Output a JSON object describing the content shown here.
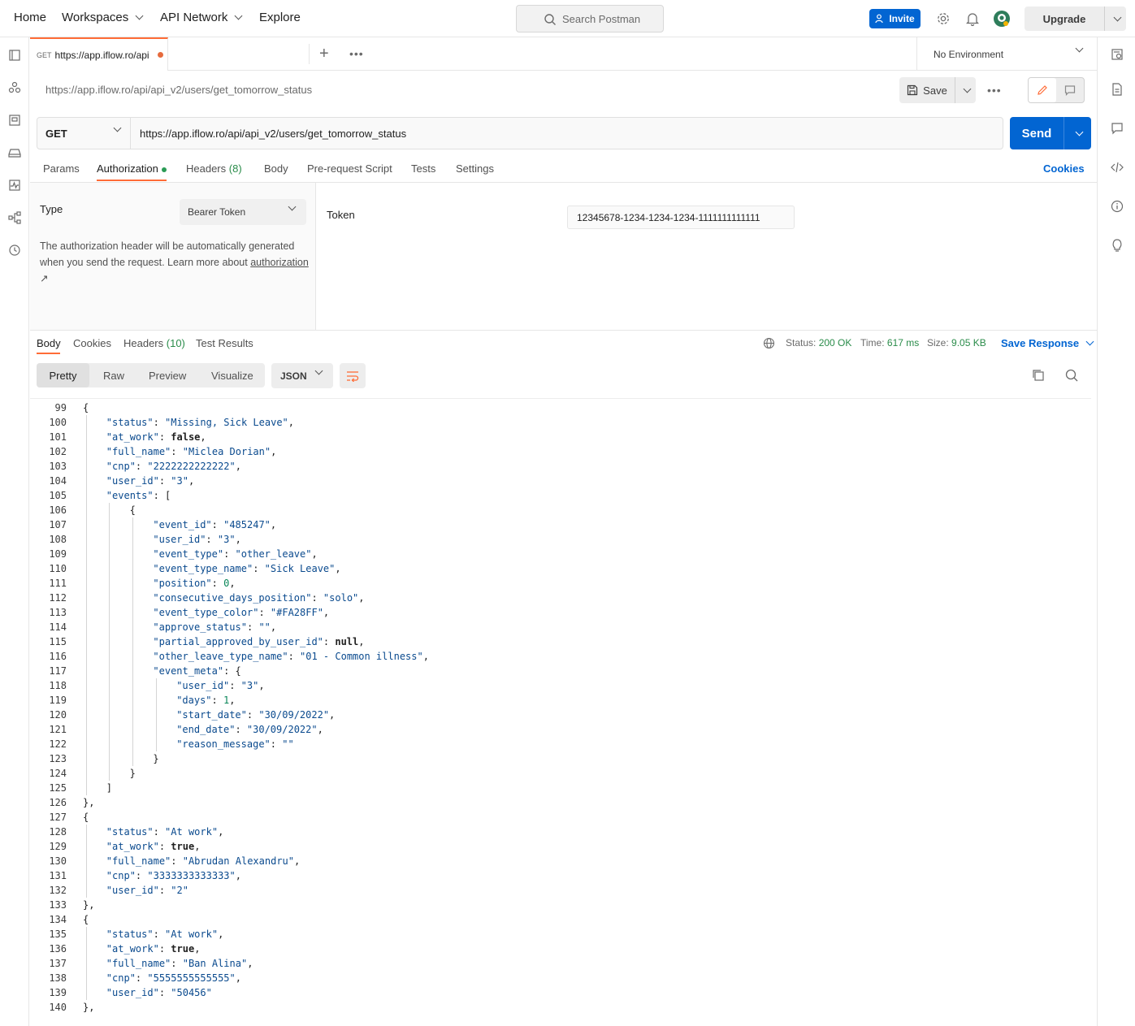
{
  "topbar": {
    "nav": [
      "Home",
      "Workspaces",
      "API Network",
      "Explore"
    ],
    "search_placeholder": "Search Postman",
    "invite_label": "Invite",
    "upgrade_label": "Upgrade"
  },
  "tabs": {
    "active_tab": {
      "method": "GET",
      "title": "https://app.iflow.ro/api"
    },
    "environment": "No Environment"
  },
  "request": {
    "name": "https://app.iflow.ro/api/api_v2/users/get_tomorrow_status",
    "save_label": "Save",
    "method": "GET",
    "url": "https://app.iflow.ro/api/api_v2/users/get_tomorrow_status",
    "send_label": "Send",
    "tabs": [
      {
        "label": "Params"
      },
      {
        "label": "Authorization"
      },
      {
        "label": "Headers",
        "count": "(8)"
      },
      {
        "label": "Body"
      },
      {
        "label": "Pre-request Script"
      },
      {
        "label": "Tests"
      },
      {
        "label": "Settings"
      }
    ],
    "cookies_label": "Cookies"
  },
  "auth": {
    "type_label": "Type",
    "type_value": "Bearer Token",
    "description": "The authorization header will be automatically generated when you send the request. Learn more about",
    "link_text": "authorization",
    "link_arrow": "↗",
    "token_label": "Token",
    "token_value": "12345678-1234-1234-1234-1111111111111"
  },
  "response": {
    "tabs": [
      {
        "label": "Body"
      },
      {
        "label": "Cookies"
      },
      {
        "label": "Headers",
        "count": "(10)"
      },
      {
        "label": "Test Results"
      }
    ],
    "status_label": "Status:",
    "status_value": "200 OK",
    "time_label": "Time:",
    "time_value": "617 ms",
    "size_label": "Size:",
    "size_value": "9.05 KB",
    "save_response_label": "Save Response",
    "view_modes": [
      "Pretty",
      "Raw",
      "Preview",
      "Visualize"
    ],
    "format": "JSON"
  },
  "code": {
    "lines": [
      {
        "n": "99",
        "indent": 1,
        "t": "{"
      },
      {
        "n": "100",
        "indent": 2,
        "key": "status",
        "val": "\"Missing, Sick Leave\"",
        "vt": "s",
        "tail": ","
      },
      {
        "n": "101",
        "indent": 2,
        "key": "at_work",
        "val": "false",
        "vt": "b",
        "tail": ","
      },
      {
        "n": "102",
        "indent": 2,
        "key": "full_name",
        "val": "\"Miclea Dorian\"",
        "vt": "s",
        "tail": ","
      },
      {
        "n": "103",
        "indent": 2,
        "key": "cnp",
        "val": "\"2222222222222\"",
        "vt": "s",
        "tail": ","
      },
      {
        "n": "104",
        "indent": 2,
        "key": "user_id",
        "val": "\"3\"",
        "vt": "s",
        "tail": ","
      },
      {
        "n": "105",
        "indent": 2,
        "key": "events",
        "val": "[",
        "vt": "p",
        "tail": ""
      },
      {
        "n": "106",
        "indent": 3,
        "t": "{"
      },
      {
        "n": "107",
        "indent": 4,
        "key": "event_id",
        "val": "\"485247\"",
        "vt": "s",
        "tail": ","
      },
      {
        "n": "108",
        "indent": 4,
        "key": "user_id",
        "val": "\"3\"",
        "vt": "s",
        "tail": ","
      },
      {
        "n": "109",
        "indent": 4,
        "key": "event_type",
        "val": "\"other_leave\"",
        "vt": "s",
        "tail": ","
      },
      {
        "n": "110",
        "indent": 4,
        "key": "event_type_name",
        "val": "\"Sick Leave\"",
        "vt": "s",
        "tail": ","
      },
      {
        "n": "111",
        "indent": 4,
        "key": "position",
        "val": "0",
        "vt": "n",
        "tail": ","
      },
      {
        "n": "112",
        "indent": 4,
        "key": "consecutive_days_position",
        "val": "\"solo\"",
        "vt": "s",
        "tail": ","
      },
      {
        "n": "113",
        "indent": 4,
        "key": "event_type_color",
        "val": "\"#FA28FF\"",
        "vt": "s",
        "tail": ","
      },
      {
        "n": "114",
        "indent": 4,
        "key": "approve_status",
        "val": "\"\"",
        "vt": "s",
        "tail": ","
      },
      {
        "n": "115",
        "indent": 4,
        "key": "partial_approved_by_user_id",
        "val": "null",
        "vt": "b",
        "tail": ","
      },
      {
        "n": "116",
        "indent": 4,
        "key": "other_leave_type_name",
        "val": "\"01 - Common illness\"",
        "vt": "s",
        "tail": ","
      },
      {
        "n": "117",
        "indent": 4,
        "key": "event_meta",
        "val": "{",
        "vt": "p",
        "tail": ""
      },
      {
        "n": "118",
        "indent": 5,
        "key": "user_id",
        "val": "\"3\"",
        "vt": "s",
        "tail": ","
      },
      {
        "n": "119",
        "indent": 5,
        "key": "days",
        "val": "1",
        "vt": "n",
        "tail": ","
      },
      {
        "n": "120",
        "indent": 5,
        "key": "start_date",
        "val": "\"30/09/2022\"",
        "vt": "s",
        "tail": ","
      },
      {
        "n": "121",
        "indent": 5,
        "key": "end_date",
        "val": "\"30/09/2022\"",
        "vt": "s",
        "tail": ","
      },
      {
        "n": "122",
        "indent": 5,
        "key": "reason_message",
        "val": "\"\"",
        "vt": "s",
        "tail": ""
      },
      {
        "n": "123",
        "indent": 4,
        "t": "}"
      },
      {
        "n": "124",
        "indent": 3,
        "t": "}"
      },
      {
        "n": "125",
        "indent": 2,
        "t": "]"
      },
      {
        "n": "126",
        "indent": 1,
        "t": "},"
      },
      {
        "n": "127",
        "indent": 1,
        "t": "{"
      },
      {
        "n": "128",
        "indent": 2,
        "key": "status",
        "val": "\"At work\"",
        "vt": "s",
        "tail": ","
      },
      {
        "n": "129",
        "indent": 2,
        "key": "at_work",
        "val": "true",
        "vt": "b",
        "tail": ","
      },
      {
        "n": "130",
        "indent": 2,
        "key": "full_name",
        "val": "\"Abrudan Alexandru\"",
        "vt": "s",
        "tail": ","
      },
      {
        "n": "131",
        "indent": 2,
        "key": "cnp",
        "val": "\"3333333333333\"",
        "vt": "s",
        "tail": ","
      },
      {
        "n": "132",
        "indent": 2,
        "key": "user_id",
        "val": "\"2\"",
        "vt": "s",
        "tail": ""
      },
      {
        "n": "133",
        "indent": 1,
        "t": "},"
      },
      {
        "n": "134",
        "indent": 1,
        "t": "{"
      },
      {
        "n": "135",
        "indent": 2,
        "key": "status",
        "val": "\"At work\"",
        "vt": "s",
        "tail": ","
      },
      {
        "n": "136",
        "indent": 2,
        "key": "at_work",
        "val": "true",
        "vt": "b",
        "tail": ","
      },
      {
        "n": "137",
        "indent": 2,
        "key": "full_name",
        "val": "\"Ban Alina\"",
        "vt": "s",
        "tail": ","
      },
      {
        "n": "138",
        "indent": 2,
        "key": "cnp",
        "val": "\"5555555555555\"",
        "vt": "s",
        "tail": ","
      },
      {
        "n": "139",
        "indent": 2,
        "key": "user_id",
        "val": "\"50456\"",
        "vt": "s",
        "tail": ""
      },
      {
        "n": "140",
        "indent": 1,
        "t": "},"
      }
    ]
  }
}
